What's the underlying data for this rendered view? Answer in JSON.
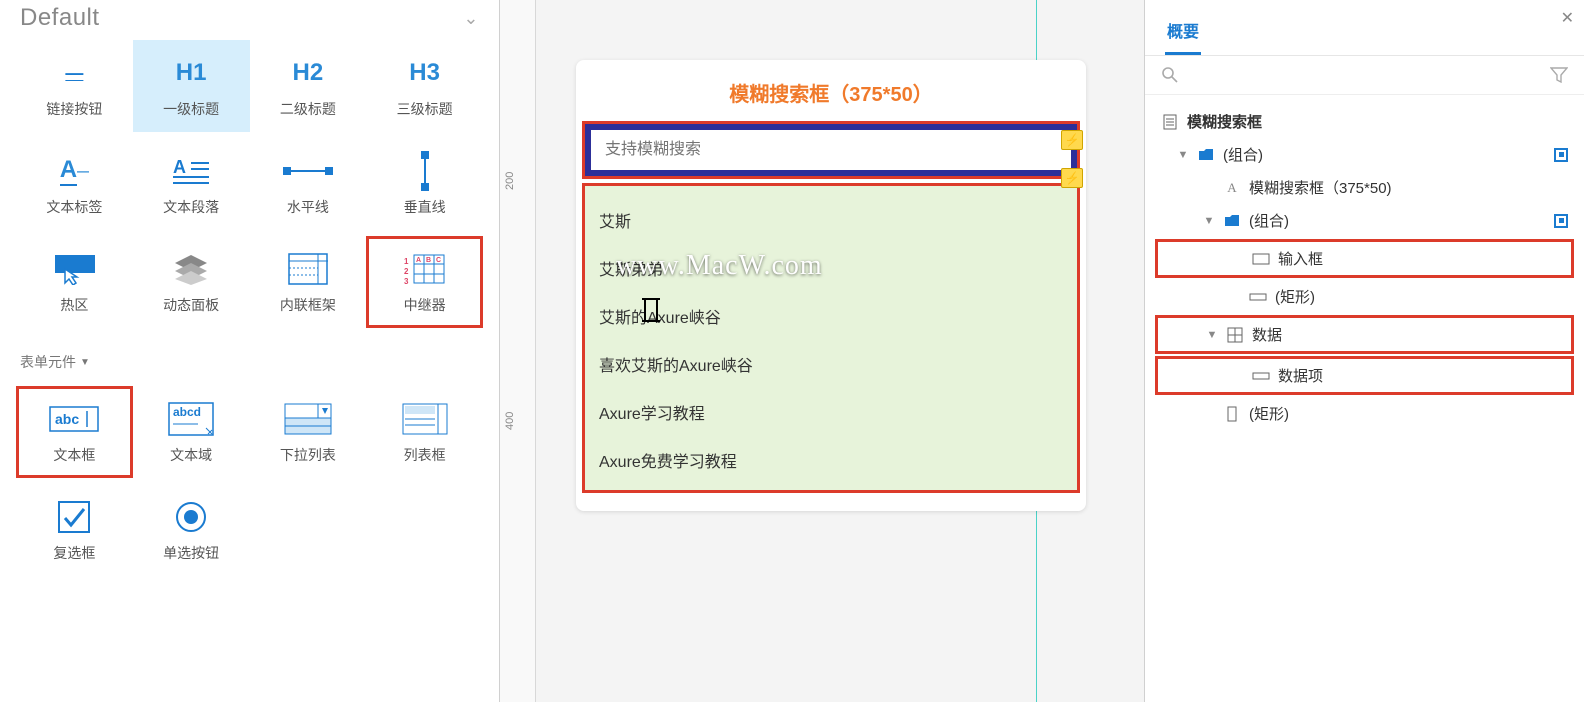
{
  "library": {
    "name": "Default",
    "row1": [
      {
        "label": "链接按钮",
        "glyph": "—"
      },
      {
        "label": "一级标题",
        "glyph": "H1"
      },
      {
        "label": "二级标题",
        "glyph": "H2"
      },
      {
        "label": "三级标题",
        "glyph": "H3"
      }
    ],
    "row2": [
      {
        "label": "文本标签",
        "glyph": "A_"
      },
      {
        "label": "文本段落",
        "glyph": "A≡"
      },
      {
        "label": "水平线",
        "glyph": "•—•"
      },
      {
        "label": "垂直线",
        "glyph": "┃"
      }
    ],
    "row3": [
      {
        "label": "热区",
        "glyph": "▭↖"
      },
      {
        "label": "动态面板",
        "glyph": "❖"
      },
      {
        "label": "内联框架",
        "glyph": "▦"
      },
      {
        "label": "中继器",
        "glyph": "⊞"
      }
    ],
    "form_section": "表单元件",
    "row4": [
      {
        "label": "文本框",
        "glyph": "abc|"
      },
      {
        "label": "文本域",
        "glyph": "abcd"
      },
      {
        "label": "下拉列表",
        "glyph": "▥▾"
      },
      {
        "label": "列表框",
        "glyph": "≣≣"
      }
    ],
    "row5": [
      {
        "label": "复选框",
        "glyph": "✓"
      },
      {
        "label": "单选按钮",
        "glyph": "◉"
      }
    ]
  },
  "canvas": {
    "ruler_ticks": [
      "200",
      "400"
    ],
    "title": "模糊搜索框（375*50）",
    "search_placeholder": "支持模糊搜索",
    "results": [
      "艾斯",
      "艾斯弟弟",
      "艾斯的Axure峡谷",
      "喜欢艾斯的Axure峡谷",
      "Axure学习教程",
      "Axure免费学习教程"
    ],
    "watermark": "www.MacW.com"
  },
  "outline": {
    "tab": "概要",
    "search_placeholder": "",
    "root": "模糊搜索框",
    "group1": "(组合)",
    "text_node": "模糊搜索框（375*50)",
    "group2": "(组合)",
    "input_node": "输入框",
    "rect_node": "(矩形)",
    "data_node": "数据",
    "data_item": "数据项",
    "rect2_node": "(矩形)"
  }
}
